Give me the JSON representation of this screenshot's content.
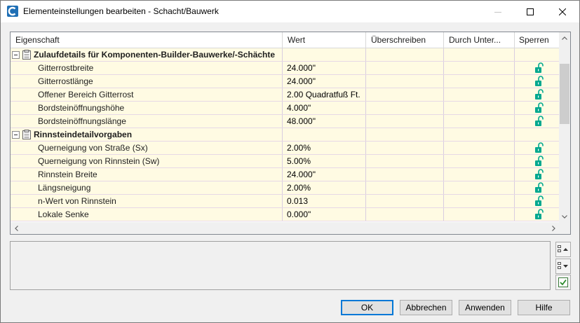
{
  "window": {
    "title": "Elementeinstellungen bearbeiten - Schacht/Bauwerk",
    "accent": "#0078d7"
  },
  "grid": {
    "columns": [
      "Eigenschaft",
      "Wert",
      "Überschreiben",
      "Durch Unter...",
      "Sperren"
    ],
    "groups": [
      {
        "title": "Zulaufdetails für Komponenten-Builder-Bauwerke/-Schächte",
        "icon": "document-group-icon",
        "rows": [
          {
            "name": "Gitterrostbreite",
            "value": "24.000\"",
            "locked": false
          },
          {
            "name": "Gitterrostlänge",
            "value": "24.000\"",
            "locked": false
          },
          {
            "name": "Offener Bereich Gitterrost",
            "value": "2.00 Quadratfuß Ft.",
            "locked": false
          },
          {
            "name": "Bordsteinöffnungshöhe",
            "value": "4.000\"",
            "locked": false
          },
          {
            "name": "Bordsteinöffnungslänge",
            "value": "48.000\"",
            "locked": false
          }
        ]
      },
      {
        "title": "Rinnsteindetailvorgaben",
        "icon": "document-group-icon",
        "rows": [
          {
            "name": "Querneigung von Straße (Sx)",
            "value": "2.00%",
            "locked": false
          },
          {
            "name": "Querneigung von Rinnstein (Sw)",
            "value": "5.00%",
            "locked": false
          },
          {
            "name": "Rinnstein Breite",
            "value": "24.000\"",
            "locked": false
          },
          {
            "name": "Längsneigung",
            "value": "2.00%",
            "locked": false
          },
          {
            "name": "n-Wert von Rinnstein",
            "value": "0.013",
            "locked": false
          },
          {
            "name": "Lokale Senke",
            "value": "0.000\"",
            "locked": false
          }
        ]
      }
    ],
    "lock_icon": "unlocked-padlock-icon",
    "lock_color": "#00a88f"
  },
  "buttons": {
    "ok": "OK",
    "cancel": "Abbrechen",
    "apply": "Anwenden",
    "help": "Hilfe"
  }
}
